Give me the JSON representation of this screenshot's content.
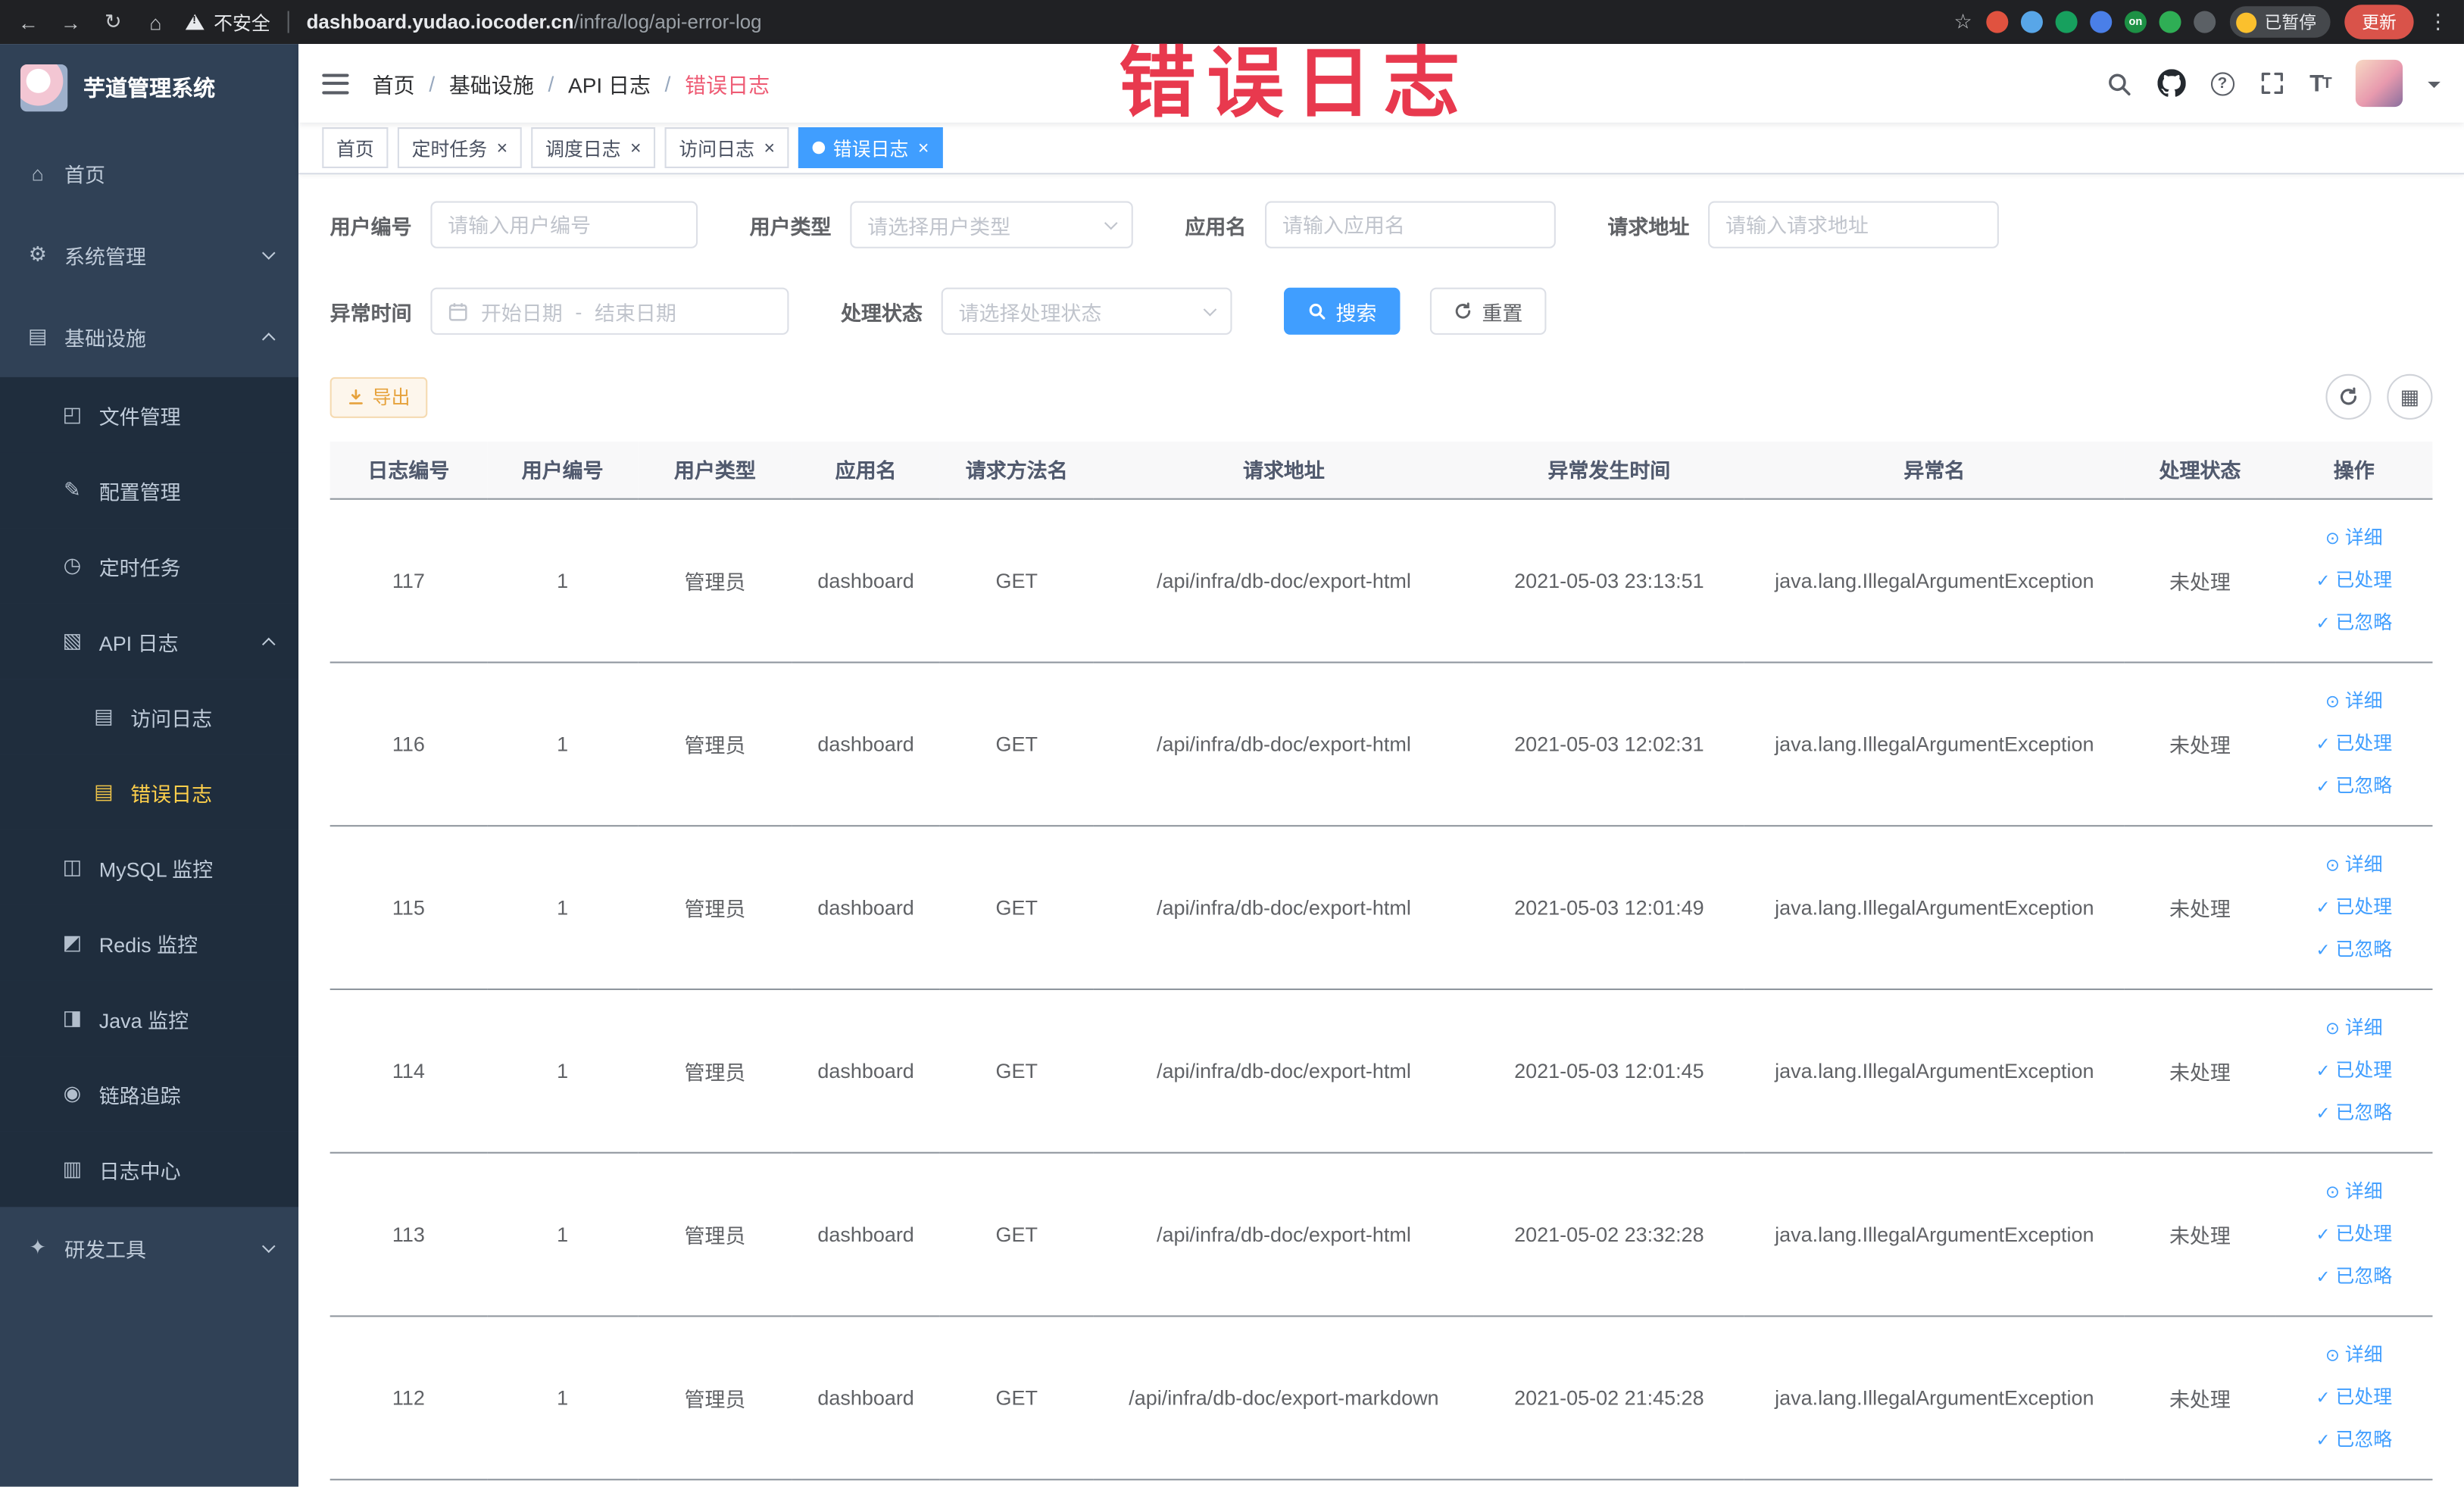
{
  "browser": {
    "security_label": "不安全",
    "url_host": "dashboard.yudao.iocoder.cn",
    "url_path": "/infra/log/api-error-log",
    "paused_badge": "已暂停",
    "update_button": "更新",
    "extensions": [
      {
        "name": "extension-icon-red",
        "color": "#e0523f",
        "label": ""
      },
      {
        "name": "extension-icon-blue-drop",
        "color": "#58a6e8",
        "label": ""
      },
      {
        "name": "extension-icon-green-circle",
        "color": "#17a05e",
        "label": ""
      },
      {
        "name": "extension-icon-blue-grid",
        "color": "#4a7fe8",
        "label": ""
      },
      {
        "name": "extension-icon-green-on",
        "color": "#1d9145",
        "label": "on"
      },
      {
        "name": "extension-icon-leaf",
        "color": "#2fae55",
        "label": ""
      },
      {
        "name": "extension-icon-dark",
        "color": "#5b6065",
        "label": ""
      }
    ]
  },
  "annotation": {
    "text": "错误日志"
  },
  "sidebar": {
    "logo_title": "芋道管理系统",
    "items": [
      {
        "key": "home",
        "label": "首页",
        "icon": "home-icon",
        "glyph": "⌂",
        "level": 1
      },
      {
        "key": "system-mgmt",
        "label": "系统管理",
        "icon": "gear-icon",
        "glyph": "⚙",
        "level": 1,
        "arrow": "down"
      },
      {
        "key": "infrastructure",
        "label": "基础设施",
        "icon": "infra-icon",
        "glyph": "▤",
        "level": 1,
        "arrow": "up"
      },
      {
        "key": "file-mgmt",
        "label": "文件管理",
        "icon": "folder-icon",
        "glyph": "◰",
        "level": 2,
        "sub": true
      },
      {
        "key": "config-mgmt",
        "label": "配置管理",
        "icon": "edit-icon",
        "glyph": "✎",
        "level": 2,
        "sub": true
      },
      {
        "key": "scheduled-tasks",
        "label": "定时任务",
        "icon": "clock-icon",
        "glyph": "◷",
        "level": 2,
        "sub": true
      },
      {
        "key": "api-log",
        "label": "API 日志",
        "icon": "api-log-icon",
        "glyph": "▧",
        "level": 2,
        "sub": true,
        "arrow": "up"
      },
      {
        "key": "access-log",
        "label": "访问日志",
        "icon": "document-icon",
        "glyph": "▤",
        "level": 3,
        "sub": true
      },
      {
        "key": "error-log",
        "label": "错误日志",
        "icon": "document-icon",
        "glyph": "▤",
        "level": 3,
        "sub": true,
        "active": true
      },
      {
        "key": "mysql-monitor",
        "label": "MySQL 监控",
        "icon": "database-icon",
        "glyph": "◫",
        "level": 2,
        "sub": true
      },
      {
        "key": "redis-monitor",
        "label": "Redis 监控",
        "icon": "redis-icon",
        "glyph": "◩",
        "level": 2,
        "sub": true
      },
      {
        "key": "java-monitor",
        "label": "Java 监控",
        "icon": "monitor-icon",
        "glyph": "◨",
        "level": 2,
        "sub": true
      },
      {
        "key": "trace",
        "label": "链路追踪",
        "icon": "eye-icon",
        "glyph": "◉",
        "level": 2,
        "sub": true
      },
      {
        "key": "log-center",
        "label": "日志中心",
        "icon": "log-icon",
        "glyph": "▥",
        "level": 2,
        "sub": true
      },
      {
        "key": "dev-tools",
        "label": "研发工具",
        "icon": "tools-icon",
        "glyph": "✦",
        "level": 1,
        "arrow": "down"
      }
    ]
  },
  "breadcrumb": {
    "items": [
      "首页",
      "基础设施",
      "API 日志",
      "错误日志"
    ]
  },
  "tabs": [
    {
      "key": "home",
      "label": "首页",
      "closable": false,
      "active": false
    },
    {
      "key": "scheduled-tasks",
      "label": "定时任务",
      "closable": true,
      "active": false
    },
    {
      "key": "schedule-log",
      "label": "调度日志",
      "closable": true,
      "active": false
    },
    {
      "key": "access-log",
      "label": "访问日志",
      "closable": true,
      "active": false
    },
    {
      "key": "error-log",
      "label": "错误日志",
      "closable": true,
      "active": true
    }
  ],
  "filters": {
    "user_id": {
      "label": "用户编号",
      "placeholder": "请输入用户编号",
      "value": ""
    },
    "user_type": {
      "label": "用户类型",
      "placeholder": "请选择用户类型"
    },
    "app_name": {
      "label": "应用名",
      "placeholder": "请输入应用名",
      "value": ""
    },
    "request_url": {
      "label": "请求地址",
      "placeholder": "请输入请求地址",
      "value": ""
    },
    "exception_time": {
      "label": "异常时间",
      "start_placeholder": "开始日期",
      "separator": "-",
      "end_placeholder": "结束日期"
    },
    "process_status": {
      "label": "处理状态",
      "placeholder": "请选择处理状态"
    },
    "search_button": "搜索",
    "reset_button": "重置"
  },
  "toolbar": {
    "export_button": "导出"
  },
  "table": {
    "headers": [
      {
        "key": "log-id",
        "label": "日志编号"
      },
      {
        "key": "user-id",
        "label": "用户编号"
      },
      {
        "key": "user-type",
        "label": "用户类型"
      },
      {
        "key": "app-name",
        "label": "应用名"
      },
      {
        "key": "method",
        "label": "请求方法名"
      },
      {
        "key": "url",
        "label": "请求地址"
      },
      {
        "key": "time",
        "label": "异常发生时间"
      },
      {
        "key": "exception",
        "label": "异常名"
      },
      {
        "key": "status",
        "label": "处理状态"
      },
      {
        "key": "actions",
        "label": "操作"
      }
    ],
    "actions": {
      "detail": "详细",
      "processed": "已处理",
      "ignored": "已忽略"
    },
    "rows": [
      {
        "id": "117",
        "user_id": "1",
        "user_type": "管理员",
        "app": "dashboard",
        "method": "GET",
        "url": "/api/infra/db-doc/export-html",
        "time": "2021-05-03 23:13:51",
        "exception": "java.lang.IllegalArgumentException",
        "status": "未处理"
      },
      {
        "id": "116",
        "user_id": "1",
        "user_type": "管理员",
        "app": "dashboard",
        "method": "GET",
        "url": "/api/infra/db-doc/export-html",
        "time": "2021-05-03 12:02:31",
        "exception": "java.lang.IllegalArgumentException",
        "status": "未处理"
      },
      {
        "id": "115",
        "user_id": "1",
        "user_type": "管理员",
        "app": "dashboard",
        "method": "GET",
        "url": "/api/infra/db-doc/export-html",
        "time": "2021-05-03 12:01:49",
        "exception": "java.lang.IllegalArgumentException",
        "status": "未处理"
      },
      {
        "id": "114",
        "user_id": "1",
        "user_type": "管理员",
        "app": "dashboard",
        "method": "GET",
        "url": "/api/infra/db-doc/export-html",
        "time": "2021-05-03 12:01:45",
        "exception": "java.lang.IllegalArgumentException",
        "status": "未处理"
      },
      {
        "id": "113",
        "user_id": "1",
        "user_type": "管理员",
        "app": "dashboard",
        "method": "GET",
        "url": "/api/infra/db-doc/export-html",
        "time": "2021-05-02 23:32:28",
        "exception": "java.lang.IllegalArgumentException",
        "status": "未处理"
      },
      {
        "id": "112",
        "user_id": "1",
        "user_type": "管理员",
        "app": "dashboard",
        "method": "GET",
        "url": "/api/infra/db-doc/export-markdown",
        "time": "2021-05-02 21:45:28",
        "exception": "java.lang.IllegalArgumentException",
        "status": "未处理"
      }
    ]
  },
  "colors": {
    "accent": "#409EFF",
    "sidebar_bg": "#304156",
    "submenu_bg": "#1f2d3d",
    "active_gold": "#ffd04b",
    "warning": "#E6A23C",
    "annotation_red": "#e8394e",
    "link_blue": "#409EFF",
    "row_border": "#8f969e"
  }
}
